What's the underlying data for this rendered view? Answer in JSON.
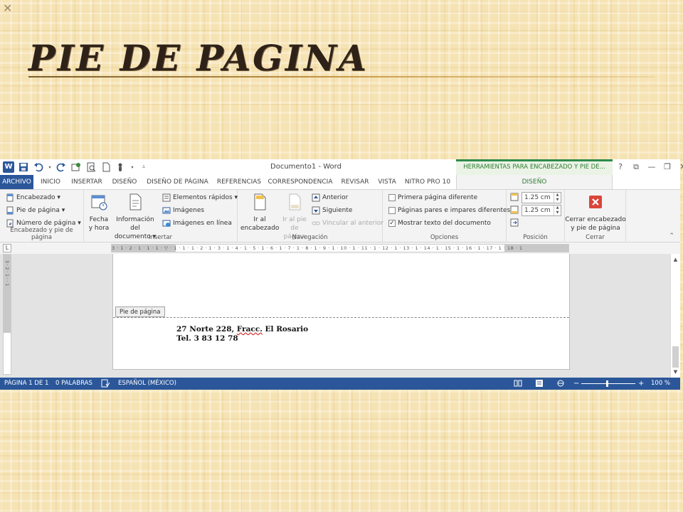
{
  "slide": {
    "title": "Pie de pagina",
    "close_glyph": "✕"
  },
  "window": {
    "title": "Documento1 - Word",
    "contextual_tab": "HERRAMIENTAS PARA ENCABEZADO Y PIE DE...",
    "controls": [
      "?",
      "⧉",
      "—",
      "❐",
      "✕"
    ]
  },
  "tabs": [
    "ARCHIVO",
    "INICIO",
    "INSERTAR",
    "DISEÑO",
    "DISEÑO DE PÁGINA",
    "REFERENCIAS",
    "CORRESPONDENCIA",
    "REVISAR",
    "VISTA",
    "NITRO PRO 10",
    "DISEÑO"
  ],
  "ribbon": {
    "hf_group": {
      "label": "Encabezado y pie de página",
      "items": [
        "Encabezado ▾",
        "Pie de página ▾",
        "Número de página ▾"
      ]
    },
    "insert_group": {
      "label": "Insertar",
      "date_btn": [
        "Fecha",
        "y hora"
      ],
      "docinfo_btn": [
        "Información del",
        "documento ▾"
      ],
      "items": [
        "Elementos rápidos ▾",
        "Imágenes",
        "Imágenes en línea"
      ]
    },
    "nav_group": {
      "label": "Navegación",
      "goto_header": [
        "Ir al",
        "encabezado"
      ],
      "goto_footer": [
        "Ir al pie",
        "de página"
      ],
      "items": [
        "Anterior",
        "Siguiente",
        "Vincular al anterior"
      ]
    },
    "options_group": {
      "label": "Opciones",
      "items": [
        {
          "label": "Primera página diferente",
          "checked": false
        },
        {
          "label": "Páginas pares e impares diferentes",
          "checked": false
        },
        {
          "label": "Mostrar texto del documento",
          "checked": true
        }
      ]
    },
    "position_group": {
      "label": "Posición",
      "header_from_top": "1.25 cm",
      "footer_from_bottom": "1.25 cm"
    },
    "close_group": {
      "label": "Cerrar",
      "button": [
        "Cerrar encabezado",
        "y pie de página"
      ]
    }
  },
  "ruler": {
    "marks": "3 · 1 · 2 · 1 · 1 · 1 · ▽ · 1 · 1 · 1 · 2 · 1 · 3 · 1 · 4 · 1 · 5 · 1 · 6 · 1 · 7 · 1 · 8 · 1 · 9 · 1 · 10 · 1 · 11 · 1 · 12 · 1 · 13 · 1 · 14 · 1 · 15 · 1 · 16 · 1 · 17 · 1 · 18 · 1",
    "vmarks": "3 · 2 · 1 · · 1"
  },
  "document": {
    "footer_tag": "Pie de página",
    "line1_pre": "27 Norte 228, ",
    "line1_err": "Fracc.",
    "line1_post": " El Rosario",
    "line2": "Tel. 3 83 12 78"
  },
  "status": {
    "page": "PÁGINA 1 DE 1",
    "words": "0 PALABRAS",
    "language": "ESPAÑOL (MÉXICO)",
    "zoom": "100 %",
    "zoom_level": 0.5
  }
}
